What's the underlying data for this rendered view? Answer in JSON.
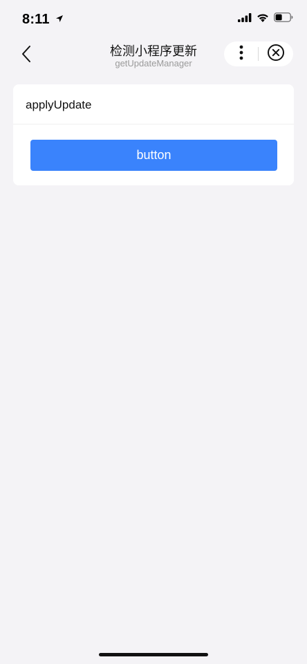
{
  "status_bar": {
    "time": "8:11",
    "location_icon": "location-arrow-icon",
    "signal_icon": "cellular-signal-icon",
    "wifi_icon": "wifi-icon",
    "battery_icon": "battery-icon"
  },
  "nav": {
    "back_icon": "chevron-left-icon",
    "title": "检测小程序更新",
    "subtitle": "getUpdateManager",
    "more_icon": "more-vertical-icon",
    "close_icon": "close-circle-icon"
  },
  "card": {
    "title": "applyUpdate",
    "button_label": "button"
  },
  "colors": {
    "page_background": "#f4f3f6",
    "primary_button": "#3a83fc",
    "card_background": "#ffffff"
  }
}
